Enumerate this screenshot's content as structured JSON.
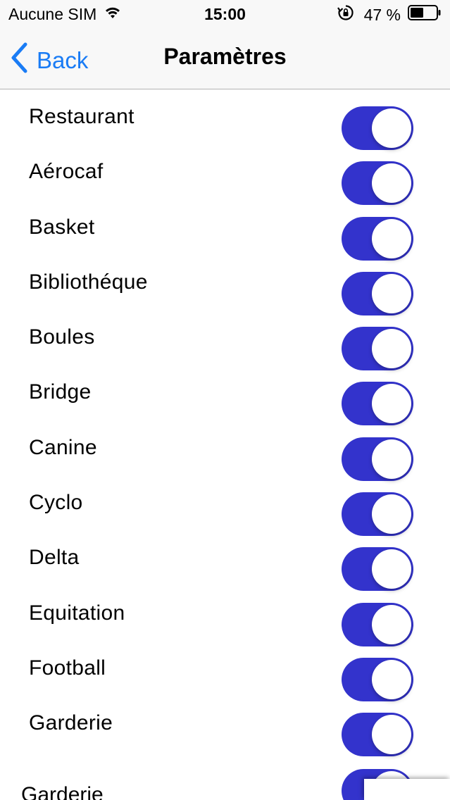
{
  "status_bar": {
    "carrier": "Aucune SIM",
    "time": "15:00",
    "battery": "47 %"
  },
  "nav": {
    "back_label": "Back",
    "title": "Paramètres"
  },
  "settings": [
    {
      "label": "Restaurant",
      "enabled": true
    },
    {
      "label": "Aérocaf",
      "enabled": true
    },
    {
      "label": "Basket",
      "enabled": true
    },
    {
      "label": "Bibliothéque",
      "enabled": true
    },
    {
      "label": "Boules",
      "enabled": true
    },
    {
      "label": "Bridge",
      "enabled": true
    },
    {
      "label": "Canine",
      "enabled": true
    },
    {
      "label": "Cyclo",
      "enabled": true
    },
    {
      "label": "Delta",
      "enabled": true
    },
    {
      "label": "Equitation",
      "enabled": true
    },
    {
      "label": "Football",
      "enabled": true
    },
    {
      "label": "Garderie",
      "enabled": true
    }
  ],
  "partial_row": {
    "label": "Garderie",
    "enabled": true
  },
  "colors": {
    "accent": "#1a7cf5",
    "toggle_on": "#3333cc",
    "bar_background": "#f8f8f8"
  }
}
